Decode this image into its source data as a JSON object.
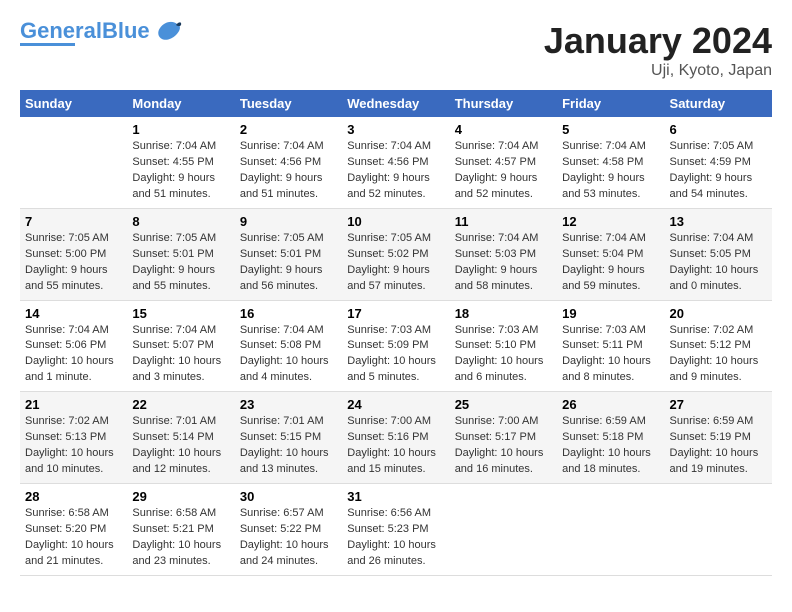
{
  "header": {
    "logo_general": "General",
    "logo_blue": "Blue",
    "title": "January 2024",
    "subtitle": "Uji, Kyoto, Japan"
  },
  "columns": [
    "Sunday",
    "Monday",
    "Tuesday",
    "Wednesday",
    "Thursday",
    "Friday",
    "Saturday"
  ],
  "weeks": [
    [
      {
        "day": "",
        "info": ""
      },
      {
        "day": "1",
        "info": "Sunrise: 7:04 AM\nSunset: 4:55 PM\nDaylight: 9 hours\nand 51 minutes."
      },
      {
        "day": "2",
        "info": "Sunrise: 7:04 AM\nSunset: 4:56 PM\nDaylight: 9 hours\nand 51 minutes."
      },
      {
        "day": "3",
        "info": "Sunrise: 7:04 AM\nSunset: 4:56 PM\nDaylight: 9 hours\nand 52 minutes."
      },
      {
        "day": "4",
        "info": "Sunrise: 7:04 AM\nSunset: 4:57 PM\nDaylight: 9 hours\nand 52 minutes."
      },
      {
        "day": "5",
        "info": "Sunrise: 7:04 AM\nSunset: 4:58 PM\nDaylight: 9 hours\nand 53 minutes."
      },
      {
        "day": "6",
        "info": "Sunrise: 7:05 AM\nSunset: 4:59 PM\nDaylight: 9 hours\nand 54 minutes."
      }
    ],
    [
      {
        "day": "7",
        "info": "Sunrise: 7:05 AM\nSunset: 5:00 PM\nDaylight: 9 hours\nand 55 minutes."
      },
      {
        "day": "8",
        "info": "Sunrise: 7:05 AM\nSunset: 5:01 PM\nDaylight: 9 hours\nand 55 minutes."
      },
      {
        "day": "9",
        "info": "Sunrise: 7:05 AM\nSunset: 5:01 PM\nDaylight: 9 hours\nand 56 minutes."
      },
      {
        "day": "10",
        "info": "Sunrise: 7:05 AM\nSunset: 5:02 PM\nDaylight: 9 hours\nand 57 minutes."
      },
      {
        "day": "11",
        "info": "Sunrise: 7:04 AM\nSunset: 5:03 PM\nDaylight: 9 hours\nand 58 minutes."
      },
      {
        "day": "12",
        "info": "Sunrise: 7:04 AM\nSunset: 5:04 PM\nDaylight: 9 hours\nand 59 minutes."
      },
      {
        "day": "13",
        "info": "Sunrise: 7:04 AM\nSunset: 5:05 PM\nDaylight: 10 hours\nand 0 minutes."
      }
    ],
    [
      {
        "day": "14",
        "info": "Sunrise: 7:04 AM\nSunset: 5:06 PM\nDaylight: 10 hours\nand 1 minute."
      },
      {
        "day": "15",
        "info": "Sunrise: 7:04 AM\nSunset: 5:07 PM\nDaylight: 10 hours\nand 3 minutes."
      },
      {
        "day": "16",
        "info": "Sunrise: 7:04 AM\nSunset: 5:08 PM\nDaylight: 10 hours\nand 4 minutes."
      },
      {
        "day": "17",
        "info": "Sunrise: 7:03 AM\nSunset: 5:09 PM\nDaylight: 10 hours\nand 5 minutes."
      },
      {
        "day": "18",
        "info": "Sunrise: 7:03 AM\nSunset: 5:10 PM\nDaylight: 10 hours\nand 6 minutes."
      },
      {
        "day": "19",
        "info": "Sunrise: 7:03 AM\nSunset: 5:11 PM\nDaylight: 10 hours\nand 8 minutes."
      },
      {
        "day": "20",
        "info": "Sunrise: 7:02 AM\nSunset: 5:12 PM\nDaylight: 10 hours\nand 9 minutes."
      }
    ],
    [
      {
        "day": "21",
        "info": "Sunrise: 7:02 AM\nSunset: 5:13 PM\nDaylight: 10 hours\nand 10 minutes."
      },
      {
        "day": "22",
        "info": "Sunrise: 7:01 AM\nSunset: 5:14 PM\nDaylight: 10 hours\nand 12 minutes."
      },
      {
        "day": "23",
        "info": "Sunrise: 7:01 AM\nSunset: 5:15 PM\nDaylight: 10 hours\nand 13 minutes."
      },
      {
        "day": "24",
        "info": "Sunrise: 7:00 AM\nSunset: 5:16 PM\nDaylight: 10 hours\nand 15 minutes."
      },
      {
        "day": "25",
        "info": "Sunrise: 7:00 AM\nSunset: 5:17 PM\nDaylight: 10 hours\nand 16 minutes."
      },
      {
        "day": "26",
        "info": "Sunrise: 6:59 AM\nSunset: 5:18 PM\nDaylight: 10 hours\nand 18 minutes."
      },
      {
        "day": "27",
        "info": "Sunrise: 6:59 AM\nSunset: 5:19 PM\nDaylight: 10 hours\nand 19 minutes."
      }
    ],
    [
      {
        "day": "28",
        "info": "Sunrise: 6:58 AM\nSunset: 5:20 PM\nDaylight: 10 hours\nand 21 minutes."
      },
      {
        "day": "29",
        "info": "Sunrise: 6:58 AM\nSunset: 5:21 PM\nDaylight: 10 hours\nand 23 minutes."
      },
      {
        "day": "30",
        "info": "Sunrise: 6:57 AM\nSunset: 5:22 PM\nDaylight: 10 hours\nand 24 minutes."
      },
      {
        "day": "31",
        "info": "Sunrise: 6:56 AM\nSunset: 5:23 PM\nDaylight: 10 hours\nand 26 minutes."
      },
      {
        "day": "",
        "info": ""
      },
      {
        "day": "",
        "info": ""
      },
      {
        "day": "",
        "info": ""
      }
    ]
  ]
}
